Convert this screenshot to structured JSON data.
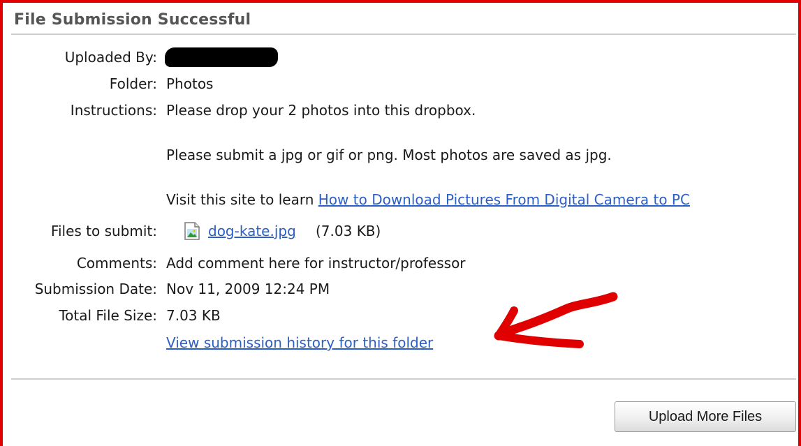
{
  "title": "File Submission Successful",
  "fields": {
    "uploaded_by_label": "Uploaded By:",
    "folder_label": "Folder:",
    "folder_value": "Photos",
    "instructions_label": "Instructions:",
    "instructions_line1": "Please drop your 2 photos into this dropbox.",
    "instructions_line2": "Please submit a jpg or gif or png. Most photos are saved as jpg.",
    "instructions_line3_prefix": "Visit this site to learn ",
    "instructions_link": "How to Download Pictures From Digital Camera to PC",
    "files_label": "Files to submit:",
    "file_name": "dog-kate.jpg",
    "file_size": "(7.03 KB)",
    "comments_label": "Comments:",
    "comments_value": "Add comment here for instructor/professor",
    "submission_date_label": "Submission Date:",
    "submission_date_value": "Nov 11, 2009 12:24 PM",
    "total_size_label": "Total File Size:",
    "total_size_value": "7.03 KB"
  },
  "history_link": "View submission history for this folder",
  "upload_button": "Upload More Files",
  "colors": {
    "annotation_red": "#e00000",
    "link_blue": "#2c5fc4"
  },
  "icons": {
    "file": "image-file-icon",
    "annotation": "red-arrow-annotation"
  }
}
